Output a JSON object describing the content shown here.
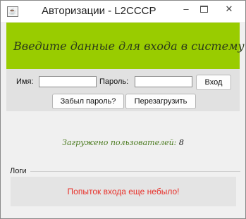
{
  "window": {
    "title": "Авторизации - L2CCCP",
    "app_icon": "java-app-icon",
    "controls": {
      "minimize": "–",
      "close": "✕"
    }
  },
  "header": {
    "text": "Введите данные для входа в систему",
    "background": "#99cc00"
  },
  "form": {
    "username_label": "Имя:",
    "username_value": "",
    "password_label": "Пароль:",
    "password_value": "",
    "login_button": "Вход",
    "forgot_button": "Забыл пароль?",
    "reload_button": "Перезагрузить"
  },
  "status": {
    "prefix": "Загружено пользователей:",
    "count": "8",
    "color": "#4a7a1e"
  },
  "logs": {
    "title": "Логи",
    "message": "Попыток входа еще небыло!",
    "message_color": "#e8312a"
  }
}
